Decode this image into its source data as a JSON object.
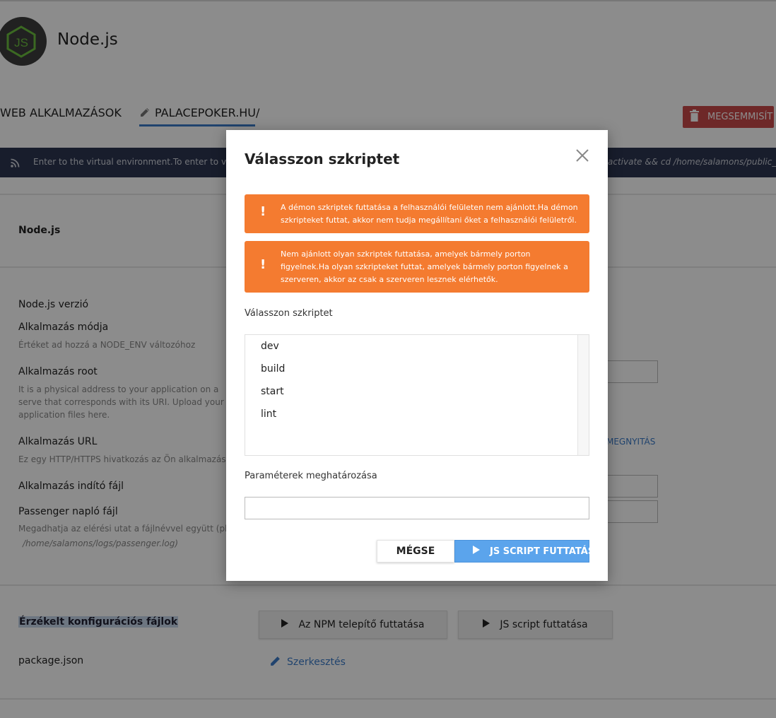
{
  "header": {
    "app_title": "Node.js",
    "logo_text": "JS"
  },
  "tabs": {
    "web_apps": "WEB ALKALMAZÁSOK",
    "current": "PALACEPOKER.HU/"
  },
  "actions": {
    "destroy": "MEGSEMMISÍT"
  },
  "env_bar": {
    "message": "Enter to the virtual environment.To enter to virtual e",
    "command": "activate && cd /home/salamons/public_html/u"
  },
  "section": {
    "title": "Node.js"
  },
  "fields": {
    "node_version": "Node.js verzió",
    "app_mode": "Alkalmazás módja",
    "app_mode_hint": "Értéket ad hozzá a NODE_ENV változóhoz",
    "app_root": "Alkalmazás root",
    "app_root_hint": "It is a physical address to your application on a serve that corresponds with its URI. Upload your application files here.",
    "app_url": "Alkalmazás URL",
    "app_url_hint": "Ez egy HTTP/HTTPS hivatkozás az Ön alkalmazásához",
    "open_link": "MEGNYITÁS",
    "startup_file": "Alkalmazás indító fájl",
    "passenger_log": "Passenger napló fájl",
    "passenger_hint_1": "Megadhatja az elérési utat a fájlnévvel együtt (pl.",
    "passenger_hint_2": "/home/salamons/logs/passenger.log)"
  },
  "config": {
    "title": "Érzékelt konfigurációs fájlok",
    "npm_button": "Az NPM telepítő futtatása",
    "js_button": "JS script futtatása",
    "file": "package.json",
    "edit": "Szerkesztés"
  },
  "modal": {
    "title": "Válasszon szkriptet",
    "alerts": [
      {
        "icon": "!",
        "text": "A démon szkriptek futtatása a felhasználói felületen nem ajánlott.Ha démon szkripteket futtat, akkor nem tudja megállítani őket a felhasználói felületről."
      },
      {
        "icon": "!",
        "text": "Nem ajánlott olyan szkriptek futtatása, amelyek bármely porton figyelnek.Ha olyan szkripteket futtat, amelyek bármely porton figyelnek a szerveren, akkor az csak a szerveren lesznek elérhetők."
      }
    ],
    "choose_label": "Válasszon szkriptet",
    "scripts": [
      "dev",
      "build",
      "start",
      "lint"
    ],
    "params_label": "Paraméterek meghatározása",
    "params_value": "",
    "cancel": "MÉGSE",
    "run": "JS SCRIPT FUTTATÁSA"
  },
  "colors": {
    "accent": "#3b7bc8",
    "warning": "#f47b30",
    "danger": "#c94a4a",
    "run_button": "#5ba4ec",
    "env_bar": "#2d3550"
  },
  "icons": [
    "nodejs-logo-icon",
    "pencil-icon",
    "trash-icon",
    "rss-icon",
    "close-icon",
    "play-icon"
  ]
}
